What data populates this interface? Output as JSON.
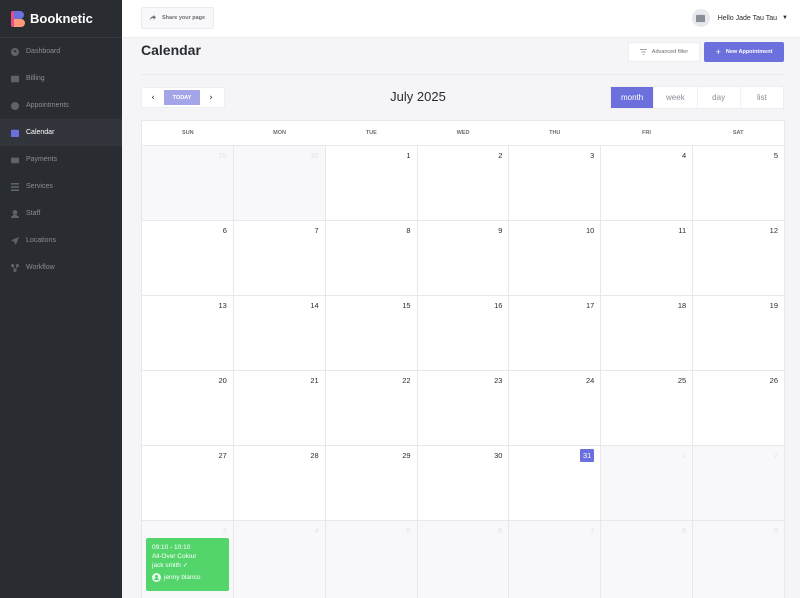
{
  "app": {
    "name": "Booknetic"
  },
  "sidebar": {
    "items": [
      {
        "label": "Dashboard",
        "icon": "dashboard-icon"
      },
      {
        "label": "Billing",
        "icon": "billing-icon"
      },
      {
        "label": "Appointments",
        "icon": "appointments-icon"
      },
      {
        "label": "Calendar",
        "icon": "calendar-icon",
        "active": true
      },
      {
        "label": "Payments",
        "icon": "payments-icon"
      },
      {
        "label": "Services",
        "icon": "services-icon"
      },
      {
        "label": "Staff",
        "icon": "staff-icon"
      },
      {
        "label": "Locations",
        "icon": "locations-icon"
      },
      {
        "label": "Workflow",
        "icon": "workflow-icon"
      }
    ]
  },
  "topbar": {
    "share_label": "Share your page",
    "user_greeting": "Hello Jade Tau Tau"
  },
  "header": {
    "title": "Calendar",
    "filter_label": "Advanced filter",
    "new_label": "New Appointment"
  },
  "toolbar": {
    "prev": "‹",
    "today": "TODAY",
    "next": "›",
    "month_label": "July 2025",
    "views": [
      "month",
      "week",
      "day",
      "list"
    ],
    "active_view": "month"
  },
  "calendar": {
    "weekdays": [
      "SUN",
      "MON",
      "TUE",
      "WED",
      "THU",
      "FRI",
      "SAT"
    ],
    "weeks": [
      [
        {
          "d": "29",
          "o": true
        },
        {
          "d": "30",
          "o": true
        },
        {
          "d": "1"
        },
        {
          "d": "2"
        },
        {
          "d": "3"
        },
        {
          "d": "4"
        },
        {
          "d": "5"
        }
      ],
      [
        {
          "d": "6"
        },
        {
          "d": "7"
        },
        {
          "d": "8"
        },
        {
          "d": "9"
        },
        {
          "d": "10"
        },
        {
          "d": "11"
        },
        {
          "d": "12"
        }
      ],
      [
        {
          "d": "13"
        },
        {
          "d": "14"
        },
        {
          "d": "15"
        },
        {
          "d": "16"
        },
        {
          "d": "17"
        },
        {
          "d": "18"
        },
        {
          "d": "19"
        }
      ],
      [
        {
          "d": "20"
        },
        {
          "d": "21"
        },
        {
          "d": "22"
        },
        {
          "d": "23"
        },
        {
          "d": "24"
        },
        {
          "d": "25"
        },
        {
          "d": "26"
        }
      ],
      [
        {
          "d": "27"
        },
        {
          "d": "28"
        },
        {
          "d": "29"
        },
        {
          "d": "30"
        },
        {
          "d": "31",
          "today": true
        },
        {
          "d": "1",
          "o": true
        },
        {
          "d": "2",
          "o": true
        }
      ],
      [
        {
          "d": "3",
          "o": true
        },
        {
          "d": "4",
          "o": true
        },
        {
          "d": "5",
          "o": true
        },
        {
          "d": "6",
          "o": true
        },
        {
          "d": "7",
          "o": true
        },
        {
          "d": "8",
          "o": true
        },
        {
          "d": "9",
          "o": true
        }
      ]
    ],
    "event": {
      "time": "09:10 - 10:10",
      "service": "All-Over Colour",
      "customer": "jack smith",
      "status_icon": "check-icon",
      "staff": "jenny blanco",
      "color": "#53d56c"
    }
  },
  "colors": {
    "accent": "#6c70dc",
    "sidebar": "#292d32",
    "event": "#53d56c"
  }
}
